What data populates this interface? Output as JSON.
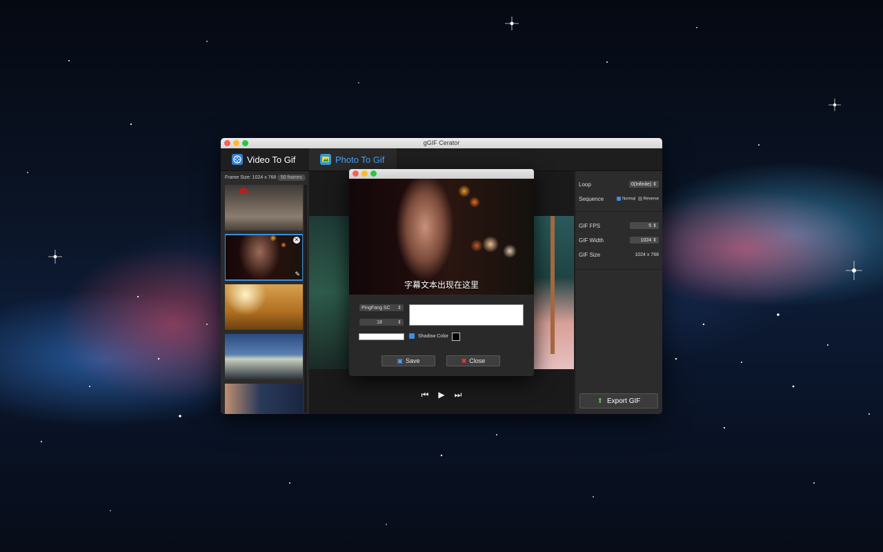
{
  "window": {
    "title": "gGIF Cerator"
  },
  "tabs": [
    {
      "label": "Video To Gif",
      "active": false
    },
    {
      "label": "Photo To Gif",
      "active": true
    }
  ],
  "sidebar": {
    "frame_size": "Frame Size: 1024 x 768",
    "frame_count": "50 frames"
  },
  "settings": {
    "loop_label": "Loop",
    "loop_value": "0(Infinite)",
    "sequence_label": "Sequence",
    "normal_label": "Normal",
    "reverse_label": "Reverse",
    "normal_checked": true,
    "reverse_checked": false,
    "fps_label": "GIF FPS",
    "fps_value": "5",
    "width_label": "GIF Width",
    "width_value": "1024",
    "size_label": "GIF Size",
    "size_value": "1024 x 768",
    "export_label": "Export GIF"
  },
  "dialog": {
    "caption": "字幕文本出现在这里",
    "font_family": "PingFang SC",
    "font_size": "18",
    "text_value": "",
    "shadow_label": "Shadow Color",
    "shadow_checked": true,
    "save_label": "Save",
    "close_label": "Close"
  },
  "colors": {
    "accent": "#3a8fe0",
    "active_tab_text": "#4aa3ff",
    "close_red": "#e23c3c"
  }
}
